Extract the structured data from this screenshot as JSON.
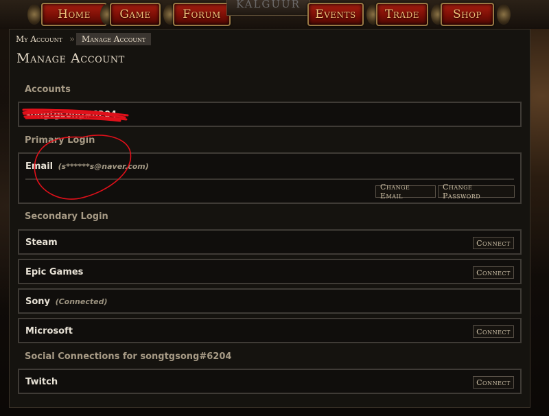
{
  "nav": {
    "crest": "KALGUUR",
    "items": [
      {
        "label": "Home"
      },
      {
        "label": "Game"
      },
      {
        "label": "Forum"
      },
      {
        "label": "Events"
      },
      {
        "label": "Trade"
      },
      {
        "label": "Shop"
      }
    ]
  },
  "breadcrumb": {
    "items": [
      {
        "label": "My Account"
      },
      {
        "label": "Manage Account"
      }
    ],
    "separator": "»"
  },
  "page": {
    "title": "Manage Account"
  },
  "accounts": {
    "section_label": "Accounts",
    "account_name": "songtgsong#6204"
  },
  "primary_login": {
    "section_label": "Primary Login",
    "label": "Email",
    "value": "(s******s@naver.com)",
    "change_email_label": "Change Email",
    "change_password_label": "Change Password"
  },
  "secondary_login": {
    "section_label": "Secondary Login",
    "items": [
      {
        "label": "Steam",
        "status": "",
        "button": "Connect"
      },
      {
        "label": "Epic Games",
        "status": "",
        "button": "Connect"
      },
      {
        "label": "Sony",
        "status": "(Connected)",
        "button": ""
      },
      {
        "label": "Microsoft",
        "status": "",
        "button": "Connect"
      }
    ]
  },
  "social": {
    "section_label": "Social Connections for songtgsong#6204",
    "items": [
      {
        "label": "Twitch",
        "button": "Connect"
      }
    ]
  },
  "colors": {
    "nav_button": "#8e160a",
    "nav_text": "#f2c07a",
    "panel_bg": "#15130f",
    "annotation_red": "#e0101a"
  }
}
